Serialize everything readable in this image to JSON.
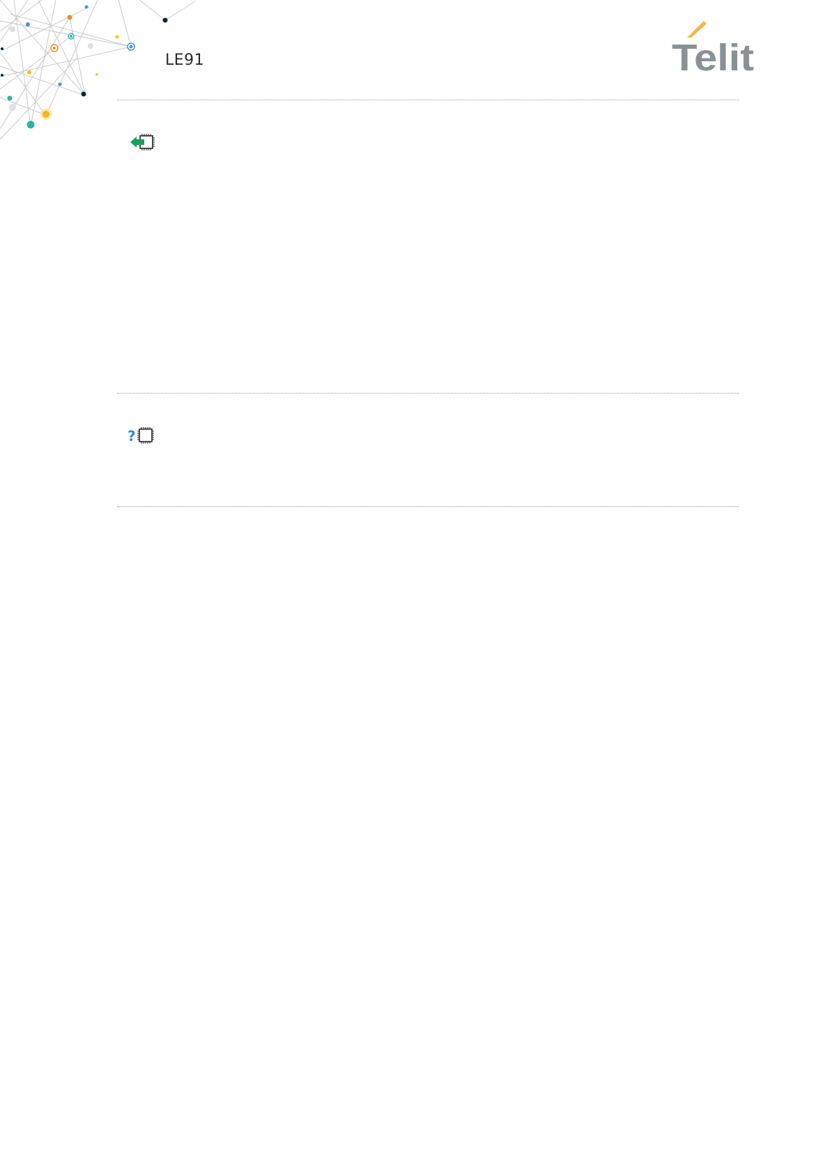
{
  "header": {
    "product": "LE91",
    "brand": "Telit"
  },
  "colors": {
    "logo_text": "#8a9196",
    "logo_accent": "#f2b64a",
    "set_arrow": "#17a05a",
    "test_question": "#2b8fc9",
    "chip_outline": "#222222",
    "separator": "#9a9a9a"
  },
  "icons": [
    "network-dots-decoration",
    "telit-logo",
    "set-command-icon",
    "test-command-icon"
  ]
}
